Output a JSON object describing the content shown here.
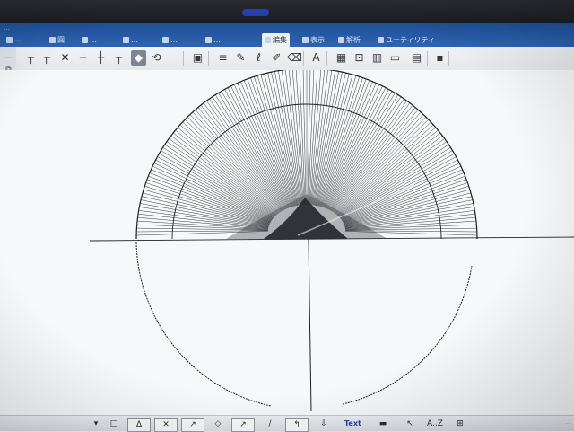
{
  "window": {
    "breadcrumb": "…"
  },
  "tabs": [
    {
      "label": "—",
      "icon": "home-icon"
    },
    {
      "label": "図",
      "icon": "shape-icon"
    },
    {
      "label": "…",
      "icon": "draw-icon"
    },
    {
      "label": "…",
      "icon": "edit-icon"
    },
    {
      "label": "…",
      "icon": "layer-icon"
    },
    {
      "label": "…",
      "icon": "menu-icon"
    },
    {
      "label": "編集",
      "icon": "edit-icon",
      "active": true
    },
    {
      "label": "表示",
      "icon": "view-icon"
    },
    {
      "label": "解析",
      "icon": "info-icon"
    },
    {
      "label": "ユーティリティ",
      "icon": "tools-icon"
    }
  ],
  "ribbon": {
    "icons": [
      "dim-top-icon",
      "dim-base-icon",
      "dim-cross-icon",
      "dim-side-icon",
      "dim-angle-icon",
      "dim-radius-icon",
      "select-shape-icon",
      "rotate-icon",
      "frame-icon",
      "hatch-icon",
      "pen-icon",
      "brush-icon",
      "marker-icon",
      "eraser-icon",
      "text-style-icon",
      "image-icon",
      "fit-icon",
      "layer-stack-icon",
      "window-icon",
      "page-icon",
      "block-icon"
    ],
    "selected_index": 6
  },
  "bottom": {
    "items": [
      {
        "label": "▾",
        "icon": "dropdown-icon"
      },
      {
        "label": "□",
        "icon": "folder-icon"
      },
      {
        "label": "∆",
        "icon": "triangle-icon"
      },
      {
        "label": "✕",
        "icon": "cross-icon"
      },
      {
        "label": "↗",
        "icon": "arrow-icon"
      },
      {
        "label": "◇",
        "icon": "snap-icon"
      },
      {
        "label": "↗",
        "icon": "line-icon"
      },
      {
        "label": "/",
        "icon": "pen-icon"
      },
      {
        "label": "↰",
        "icon": "turn-icon"
      },
      {
        "label": "⇩",
        "icon": "move-down-icon"
      },
      {
        "label": "Text",
        "icon": "text-icon"
      },
      {
        "label": "▬",
        "icon": "table-icon"
      },
      {
        "label": "↖",
        "icon": "pointer-icon"
      },
      {
        "label": "A..Z",
        "icon": "sort-icon"
      },
      {
        "label": "⊞",
        "icon": "grid-icon"
      }
    ],
    "status": "…"
  },
  "colors": {
    "tabbar": "#2e63b4",
    "line": "#1e2024",
    "canvas": "#f7f8f9"
  }
}
